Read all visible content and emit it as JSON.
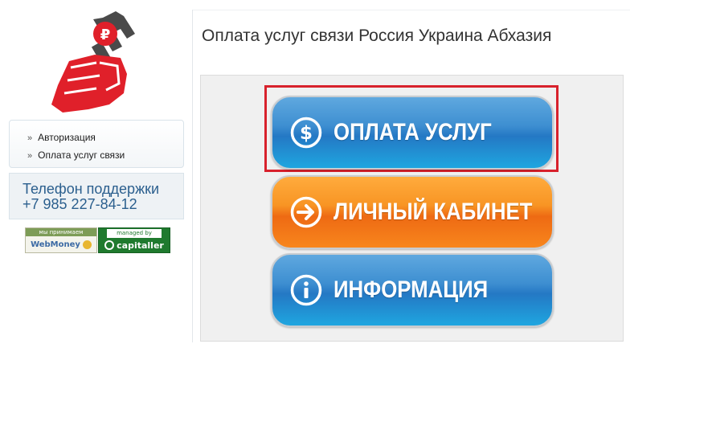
{
  "nav": {
    "items": [
      {
        "label": "Авторизация"
      },
      {
        "label": "Оплата услуг связи"
      }
    ],
    "bullet": "»"
  },
  "support": {
    "line1": "Телефон поддержки",
    "line2": "+7 985 227-84-12"
  },
  "badges": {
    "webmoney_top": "мы принимаем",
    "webmoney_bottom": "WebMoney",
    "capitaller_top": "managed by",
    "capitaller_bottom": "capitaller"
  },
  "main": {
    "title": "Оплата услуг связи Россия Украина Абхазия",
    "buttons": [
      {
        "label": "ОПЛАТА УСЛУГ",
        "icon": "dollar-icon",
        "color": "#2478c4"
      },
      {
        "label": "ЛИЧНЫЙ КАБИНЕТ",
        "icon": "arrow-right-icon",
        "color": "#f07a18"
      },
      {
        "label": "ИНФОРМАЦИЯ",
        "icon": "info-icon",
        "color": "#2478c4"
      }
    ]
  },
  "colors": {
    "highlight": "#d8212c",
    "logo_red": "#e0202a",
    "logo_dark": "#4a4a4a"
  }
}
